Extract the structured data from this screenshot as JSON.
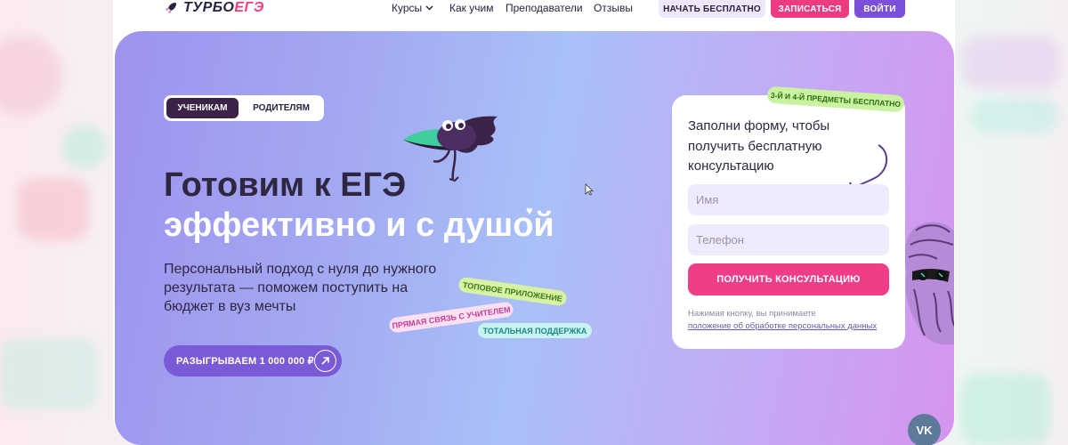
{
  "header": {
    "logo_part1": "ТУРБО",
    "logo_part2": "ЕГЭ",
    "nav": {
      "courses": "Курсы",
      "how_we_teach": "Как учим",
      "teachers": "Преподаватели",
      "reviews": "Отзывы"
    },
    "buttons": {
      "start_free": "НАЧАТЬ БЕСПЛАТНО",
      "sign_up": "ЗАПИСАТЬСЯ",
      "login": "ВОЙТИ"
    }
  },
  "hero": {
    "tabs": {
      "students": "УЧЕНИКАМ",
      "parents": "РОДИТЕЛЯМ",
      "active": "students"
    },
    "headline_line1": "Готовим к ЕГЭ",
    "headline_line2": "эффективно и с душой",
    "subtitle": "Персональный подход с нуля до нужного результата — поможем поступить на бюджет в вуз мечты",
    "stickers": {
      "top_app": "ТОПОВОЕ ПРИЛОЖЕНИЕ",
      "direct_contact": "ПРЯМАЯ СВЯЗЬ С УЧИТЕЛЕМ",
      "total_support": "ТОТАЛЬНАЯ ПОДДЕРЖКА"
    },
    "prize_button": "РАЗЫГРЫВАЕМ 1 000 000 ₽"
  },
  "form": {
    "badge": "3-Й И 4-Й ПРЕДМЕТЫ БЕСПЛАТНО",
    "title": "Заполни форму, чтобы получить бесплатную консультацию",
    "name_placeholder": "Имя",
    "phone_placeholder": "Телефон",
    "submit_label": "ПОЛУЧИТЬ КОНСУЛЬТАЦИЮ",
    "consent_text": "Нажимая кнопку, вы принимаете",
    "consent_link": "положение об обработке персональных данных"
  },
  "social": {
    "vk_label": "VK"
  },
  "colors": {
    "accent_pink": "#ef3e87",
    "accent_purple": "#7a4fd9",
    "dark_text": "#2f2640",
    "hero_gradient_start": "#9d93ee",
    "hero_gradient_end": "#d694ef"
  }
}
